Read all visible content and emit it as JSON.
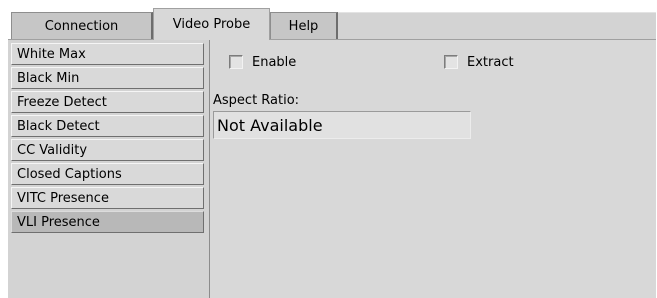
{
  "tabs": [
    {
      "label": "Connection",
      "active": false
    },
    {
      "label": "Video Probe",
      "active": true
    },
    {
      "label": "Help",
      "active": false
    }
  ],
  "sidebar": {
    "selected": "VLI Presence",
    "items": [
      {
        "label": "White Max"
      },
      {
        "label": "Black Min"
      },
      {
        "label": "Freeze Detect"
      },
      {
        "label": "Black Detect"
      },
      {
        "label": "CC Validity"
      },
      {
        "label": "Closed Captions"
      },
      {
        "label": "VITC Presence"
      },
      {
        "label": "VLI Presence"
      }
    ]
  },
  "main": {
    "enable": {
      "label": "Enable",
      "checked": false
    },
    "extract": {
      "label": "Extract",
      "checked": false
    },
    "aspect_ratio": {
      "label": "Aspect Ratio:",
      "value": "Not Available"
    }
  }
}
